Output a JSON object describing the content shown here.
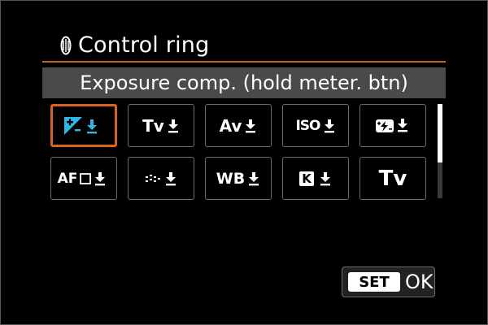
{
  "header": {
    "title": "Control ring",
    "icon": "control-ring-icon"
  },
  "description": "Exposure comp. (hold meter. btn)",
  "colors": {
    "accent": "#d9631f",
    "exposure_icon": "#2fb8e6",
    "bar": "#4a4a4a"
  },
  "options": [
    {
      "id": "exposure-comp",
      "label": "",
      "icon": "exposure-compensation-icon",
      "selected": true
    },
    {
      "id": "tv",
      "label": "Tv",
      "icon": "lock-arrow-icon",
      "selected": false
    },
    {
      "id": "av",
      "label": "Av",
      "icon": "lock-arrow-icon",
      "selected": false
    },
    {
      "id": "iso",
      "label": "ISO",
      "icon": "lock-arrow-icon",
      "selected": false
    },
    {
      "id": "flash-comp",
      "label": "",
      "icon": "flash-exposure-compensation-icon",
      "selected": false
    },
    {
      "id": "af",
      "label": "AF",
      "icon": "af-point-icon",
      "selected": false
    },
    {
      "id": "drive",
      "label": "",
      "icon": "drive-mode-icon",
      "selected": false
    },
    {
      "id": "wb",
      "label": "WB",
      "icon": "lock-arrow-icon",
      "selected": false
    },
    {
      "id": "color-temp",
      "label": "K",
      "icon": "color-temperature-icon",
      "selected": false
    },
    {
      "id": "tv-plain",
      "label": "Tv",
      "icon": "",
      "selected": false
    }
  ],
  "footer": {
    "set_label": "SET",
    "ok_label": "OK"
  }
}
